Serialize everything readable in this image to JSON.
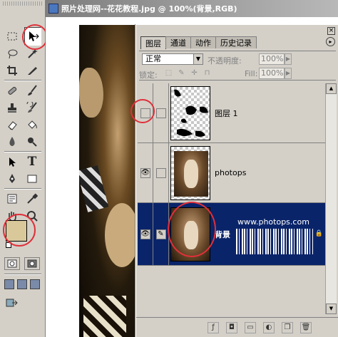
{
  "document": {
    "title": "照片处理网--花花教程.jpg @ 100%(背景,RGB)"
  },
  "toolbox": {
    "tools": [
      {
        "name": "marquee-tool-icon"
      },
      {
        "name": "move-tool-icon"
      },
      {
        "name": "lasso-tool-icon"
      },
      {
        "name": "magic-wand-tool-icon"
      },
      {
        "name": "crop-tool-icon"
      },
      {
        "name": "slice-tool-icon"
      },
      {
        "name": "healing-brush-icon"
      },
      {
        "name": "brush-tool-icon"
      },
      {
        "name": "clone-stamp-icon"
      },
      {
        "name": "history-brush-icon"
      },
      {
        "name": "eraser-tool-icon"
      },
      {
        "name": "paint-bucket-icon"
      },
      {
        "name": "blur-tool-icon"
      },
      {
        "name": "dodge-tool-icon"
      },
      {
        "name": "path-selection-icon"
      },
      {
        "name": "type-tool-icon"
      },
      {
        "name": "pen-tool-icon"
      },
      {
        "name": "rectangle-tool-icon"
      },
      {
        "name": "notes-tool-icon"
      },
      {
        "name": "eyedropper-tool-icon"
      },
      {
        "name": "hand-tool-icon"
      },
      {
        "name": "zoom-tool-icon"
      }
    ],
    "type_glyph": "T",
    "foreground_color": "#d8c89a",
    "background_color": "#ffffff"
  },
  "panel": {
    "tabs": [
      {
        "label": "图层",
        "active": true
      },
      {
        "label": "通道",
        "active": false
      },
      {
        "label": "动作",
        "active": false
      },
      {
        "label": "历史记录",
        "active": false
      }
    ],
    "close_glyph": "×",
    "blend_mode": "正常",
    "opacity_label": "不透明度:",
    "opacity_value": "100%",
    "lock_label": "锁定:",
    "fill_label": "Fill:",
    "fill_value": "100%",
    "layers": [
      {
        "name": "图层 1",
        "visible": false,
        "selected": false
      },
      {
        "name": "photops",
        "visible": true,
        "selected": false
      },
      {
        "name": "背景",
        "visible": true,
        "selected": true,
        "watermark": "www.photops.com"
      }
    ]
  },
  "colors": {
    "selection": "#0a246a",
    "annotation_circle": "#e0303a",
    "foreground_swatch": "#d8c89a"
  }
}
